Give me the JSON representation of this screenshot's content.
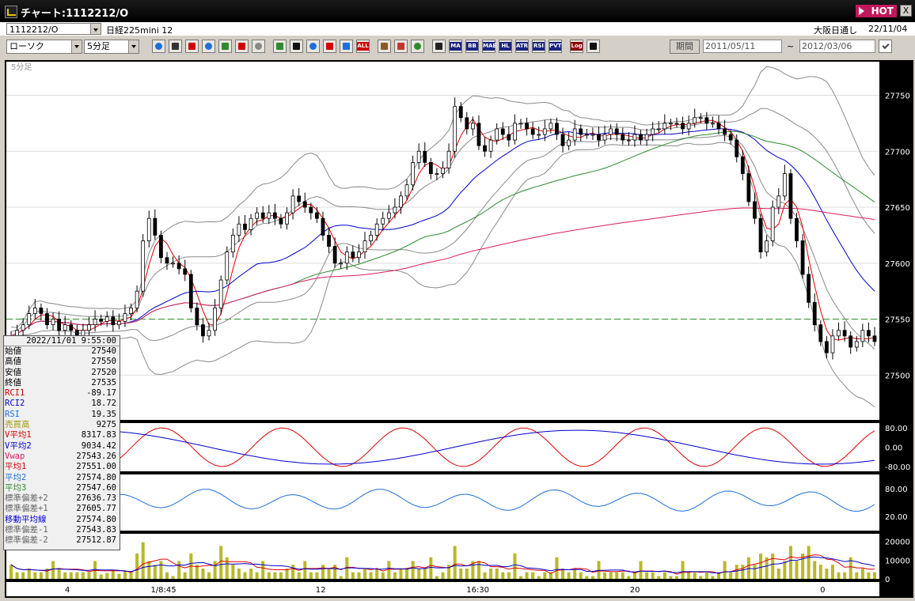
{
  "titlebar": {
    "title": "チャート:1112212/O",
    "hot": "HOT",
    "close": "X"
  },
  "toolbar1": {
    "symbol": "1112212/O",
    "name": "日経225mini 12",
    "session": "大阪日通し",
    "date": "22/11/04"
  },
  "toolbar2": {
    "chart_type": "ローソク",
    "period": "5分足",
    "kikan": "期間",
    "from_date": "2011/05/11",
    "tilde": "~",
    "to_date": "2012/03/06",
    "icons": [
      "zoom-icon",
      "crosshair-icon",
      "cursor-icon",
      "circle-q-icon",
      "candle-icon",
      "arrows-icon",
      "exclaim-icon",
      "pencil-icon",
      "pointer-icon",
      "undo-icon",
      "plus-icon",
      "cross-icon",
      "all-icon",
      "gear-icon",
      "brush-icon",
      "palette-icon",
      "ichimoku-icon",
      "ma-icon",
      "bb-icon",
      "mae-icon",
      "hl-icon",
      "atr-icon",
      "rsi-icon",
      "pvt-icon",
      "log-icon",
      "print-icon"
    ],
    "icon_labels": [
      "MA",
      "BB",
      "MAE",
      "HL",
      "ATR",
      "RSI",
      "PVT",
      "Log",
      "ALL"
    ]
  },
  "colors": {
    "background": "#000000",
    "panel": "#d4d0c8",
    "red": "#e00000",
    "blue": "#0000cc",
    "green": "#2d8a2d",
    "magenta": "#d81b60",
    "gray": "#808080",
    "olive": "#b8b82a"
  },
  "chart_data": {
    "type": "candlestick",
    "period_label": "5分足",
    "ylim": [
      27460,
      27780
    ],
    "y_ticks": [
      27750,
      27700,
      27650,
      27600,
      27550,
      27500
    ],
    "x_ticks": [
      "4",
      "1/8:45",
      "12",
      "16:30",
      "20",
      "0"
    ],
    "close": [
      27535,
      27540,
      27545,
      27555,
      27560,
      27555,
      27545,
      27550,
      27540,
      27545,
      27540,
      27535,
      27540,
      27545,
      27550,
      27548,
      27552,
      27545,
      27548,
      27555,
      27560,
      27575,
      27620,
      27640,
      27625,
      27605,
      27600,
      27600,
      27595,
      27590,
      27560,
      27545,
      27535,
      27540,
      27560,
      27585,
      27610,
      27625,
      27635,
      27630,
      27640,
      27645,
      27640,
      27645,
      27640,
      27635,
      27645,
      27660,
      27655,
      27650,
      27645,
      27640,
      27625,
      27615,
      27600,
      27600,
      27610,
      27605,
      27610,
      27620,
      27625,
      27635,
      27640,
      27645,
      27650,
      27660,
      27670,
      27690,
      27700,
      27690,
      27680,
      27680,
      27685,
      27700,
      27740,
      27730,
      27720,
      27725,
      27705,
      27700,
      27710,
      27720,
      27715,
      27710,
      27725,
      27725,
      27720,
      27715,
      27715,
      27720,
      27725,
      27715,
      27705,
      27710,
      27720,
      27715,
      27715,
      27715,
      27710,
      27715,
      27720,
      27715,
      27710,
      27710,
      27715,
      27710,
      27715,
      27720,
      27720,
      27725,
      27725,
      27725,
      27720,
      27725,
      27730,
      27730,
      27725,
      27725,
      27720,
      27715,
      27710,
      27695,
      27680,
      27655,
      27640,
      27610,
      27620,
      27650,
      27660,
      27680,
      27640,
      27620,
      27590,
      27565,
      27545,
      27530,
      27520,
      27535,
      27540,
      27535,
      27525,
      27530,
      27540,
      27535,
      27530
    ],
    "series": [
      {
        "name": "RCI1",
        "value": -89.17
      },
      {
        "name": "RCI2",
        "value": 18.72
      },
      {
        "name": "RSI",
        "value": 19.35
      },
      {
        "name": "V平均1",
        "value": 8317.83
      },
      {
        "name": "V平均2",
        "value": 9034.42
      },
      {
        "name": "Vwap",
        "value": 27543.26
      },
      {
        "name": "平均1",
        "value": 27551.0
      },
      {
        "name": "平均2",
        "value": 27574.8
      },
      {
        "name": "平均3",
        "value": 27547.6
      }
    ],
    "rci_ticks": [
      "80.00",
      "0.00",
      "-80.00"
    ],
    "rsi_ticks": [
      "80.00",
      "20.00"
    ],
    "volume_ticks": [
      "20000",
      "10000",
      "0"
    ]
  },
  "info": {
    "datetime": "2022/11/01 9:55:00",
    "rows": [
      {
        "k": "始値",
        "v": "27540",
        "c": "#000"
      },
      {
        "k": "高値",
        "v": "27550",
        "c": "#000"
      },
      {
        "k": "安値",
        "v": "27520",
        "c": "#000"
      },
      {
        "k": "終値",
        "v": "27535",
        "c": "#000"
      },
      {
        "k": "RCI1",
        "v": "-89.17",
        "c": "#d00000"
      },
      {
        "k": "RCI2",
        "v": "18.72",
        "c": "#0000cc"
      },
      {
        "k": "RSI",
        "v": "19.35",
        "c": "#1e6fd9"
      },
      {
        "k": "売買高",
        "v": "9275",
        "c": "#9a9a00"
      },
      {
        "k": "V平均1",
        "v": "8317.83",
        "c": "#d00000"
      },
      {
        "k": "V平均2",
        "v": "9034.42",
        "c": "#0000cc"
      },
      {
        "k": "Vwap",
        "v": "27543.26",
        "c": "#d81b60"
      },
      {
        "k": "平均1",
        "v": "27551.00",
        "c": "#d00000"
      },
      {
        "k": "平均2",
        "v": "27574.80",
        "c": "#1e6fd9"
      },
      {
        "k": "平均3",
        "v": "27547.60",
        "c": "#2d8a2d"
      },
      {
        "k": "標準偏差+2",
        "v": "27636.73",
        "c": "#666"
      },
      {
        "k": "標準偏差+1",
        "v": "27605.77",
        "c": "#666"
      },
      {
        "k": "移動平均線",
        "v": "27574.80",
        "c": "#0000cc"
      },
      {
        "k": "標準偏差-1",
        "v": "27543.83",
        "c": "#666"
      },
      {
        "k": "標準偏差-2",
        "v": "27512.87",
        "c": "#666"
      }
    ]
  }
}
